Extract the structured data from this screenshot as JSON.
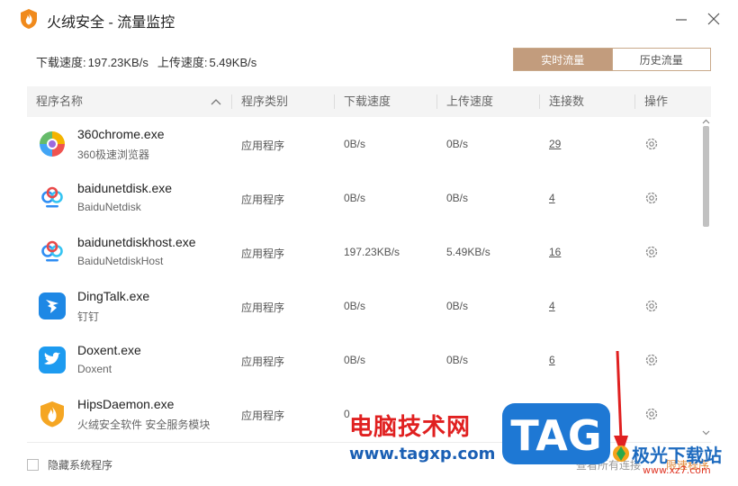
{
  "window": {
    "title": "火绒安全 - 流量监控",
    "minimize_icon": "minimize-icon",
    "close_icon": "close-icon"
  },
  "speed": {
    "download_label": "下载速度:",
    "download_value": "197.23KB/s",
    "upload_label": "上传速度:",
    "upload_value": "5.49KB/s"
  },
  "tabs": [
    {
      "label": "实时流量",
      "active": true
    },
    {
      "label": "历史流量",
      "active": false
    }
  ],
  "table": {
    "headers": [
      "程序名称",
      "程序类别",
      "下载速度",
      "上传速度",
      "连接数",
      "操作"
    ],
    "rows": [
      {
        "name": "360chrome.exe",
        "desc": "360极速浏览器",
        "category": "应用程序",
        "download": "0B/s",
        "upload": "0B/s",
        "connections": "29",
        "icon": "360chrome-icon"
      },
      {
        "name": "baidunetdisk.exe",
        "desc": "BaiduNetdisk",
        "category": "应用程序",
        "download": "0B/s",
        "upload": "0B/s",
        "connections": "4",
        "icon": "baidunetdisk-icon"
      },
      {
        "name": "baidunetdiskhost.exe",
        "desc": "BaiduNetdiskHost",
        "category": "应用程序",
        "download": "197.23KB/s",
        "upload": "5.49KB/s",
        "connections": "16",
        "icon": "baidunetdisk-icon"
      },
      {
        "name": "DingTalk.exe",
        "desc": "钉钉",
        "category": "应用程序",
        "download": "0B/s",
        "upload": "0B/s",
        "connections": "4",
        "icon": "dingtalk-icon"
      },
      {
        "name": "Doxent.exe",
        "desc": "Doxent",
        "category": "应用程序",
        "download": "0B/s",
        "upload": "0B/s",
        "connections": "6",
        "icon": "doxent-bird-icon"
      },
      {
        "name": "HipsDaemon.exe",
        "desc": "火绒安全软件 安全服务模块",
        "category": "应用程序",
        "download": "0",
        "upload": "",
        "connections": "",
        "icon": "huorong-shield-icon"
      }
    ]
  },
  "footer": {
    "hide_system_label": "隐藏系统程序",
    "link_view": "查看所有连接",
    "link_limit": "限速程序"
  },
  "watermark": {
    "site_text": "电脑技术网",
    "site_url": "www.tagxp.com",
    "tag_text": "TAG",
    "jg_text": "极光下载站",
    "jg_url": "www.xz7.com"
  },
  "colors": {
    "accent": "#c29c7d",
    "tab_border": "#c9a98a",
    "header_bg": "#f4f4f4",
    "link_orange": "#e08a3a"
  }
}
